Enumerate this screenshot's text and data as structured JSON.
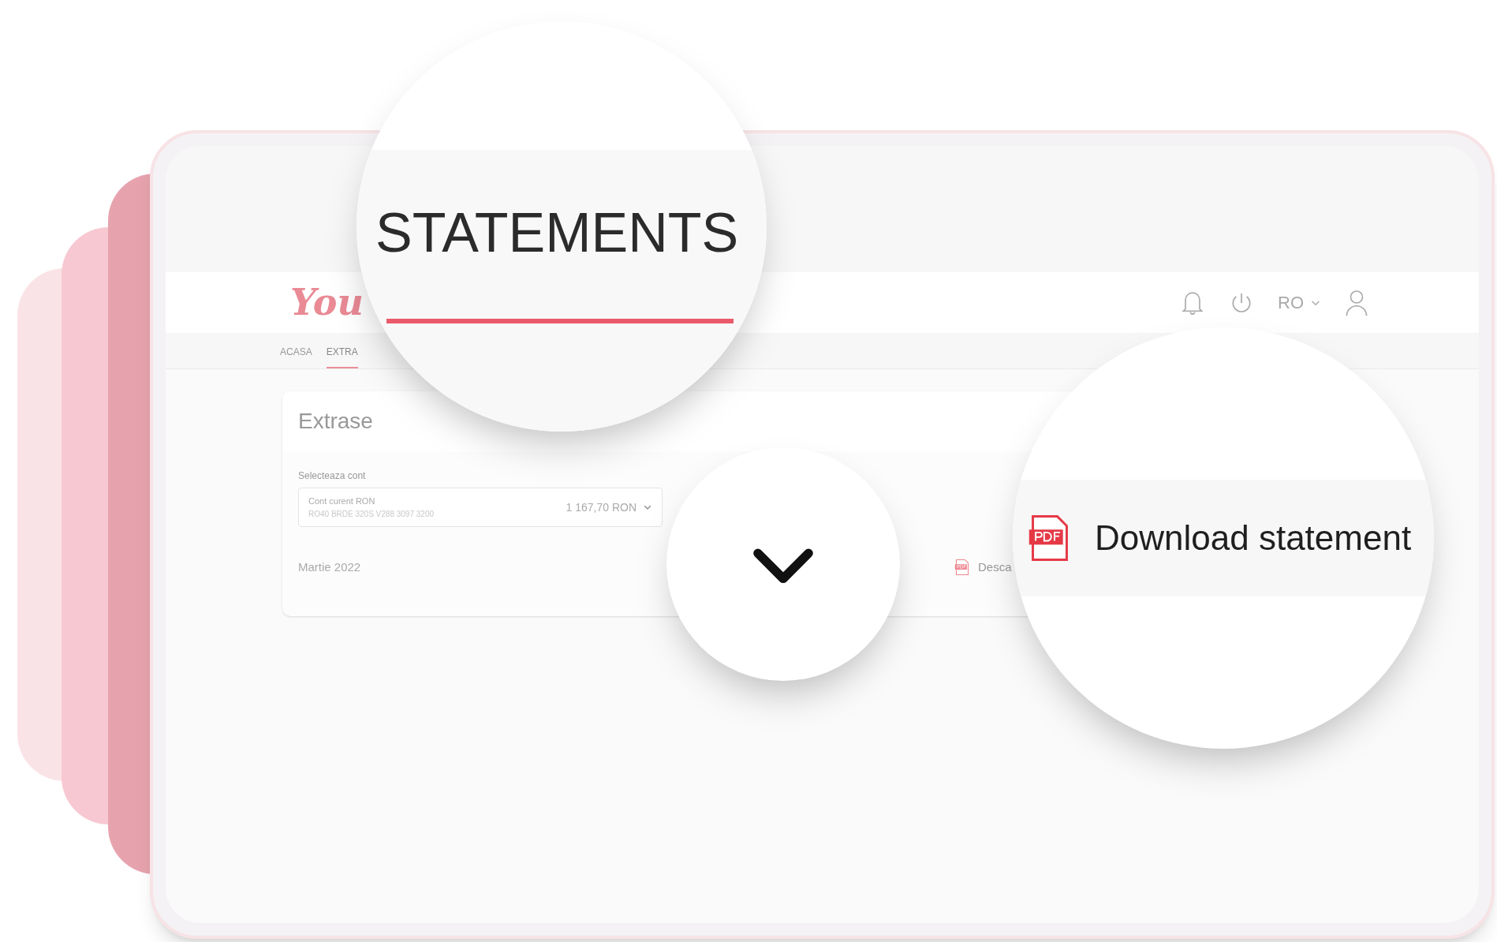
{
  "header": {
    "logo": "You",
    "language": "RO"
  },
  "tabs": [
    {
      "label": "ACASA",
      "selected": false
    },
    {
      "label": "EXTRA",
      "selected": true
    }
  ],
  "card": {
    "title": "Extrase",
    "account_label": "Selecteaza cont",
    "account": {
      "name": "Cont curent RON",
      "iban": "RO40 BRDE 320S V288 3097 3200",
      "balance": "1 167,70 RON"
    },
    "statements": [
      {
        "period": "Martie 2022",
        "action": "Desca"
      }
    ]
  },
  "zoom_tab": {
    "label": "STATEMENTS",
    "selected": true
  },
  "zoom_download": {
    "label": "Download statement"
  }
}
